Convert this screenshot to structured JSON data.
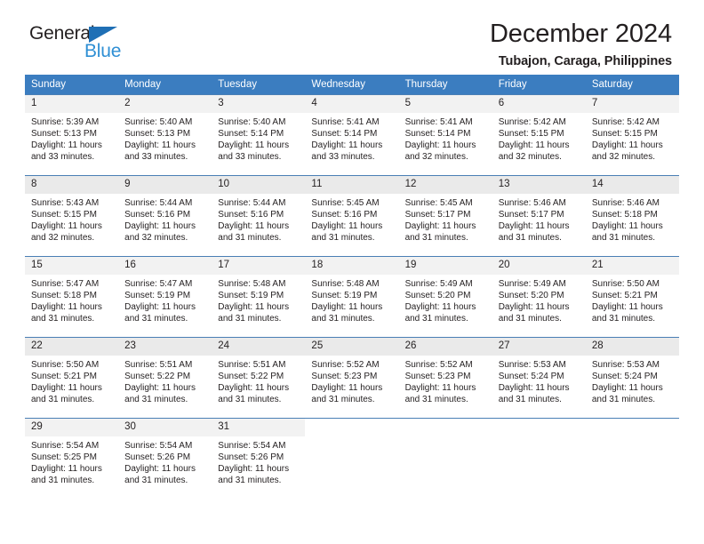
{
  "brand": {
    "word_one": "General",
    "word_two": "Blue",
    "triangle_color": "#1f6fb5",
    "blue_color": "#2f8fd4"
  },
  "header": {
    "title": "December 2024",
    "subtitle": "Tubajon, Caraga, Philippines"
  },
  "theme": {
    "header_bg": "#3b7dc0",
    "row_border": "#4a7fb5",
    "daynum_bg": "#f2f2f2"
  },
  "calendar": {
    "weekday_headers": [
      "Sunday",
      "Monday",
      "Tuesday",
      "Wednesday",
      "Thursday",
      "Friday",
      "Saturday"
    ],
    "weeks": [
      [
        {
          "day": "1",
          "sunrise": "Sunrise: 5:39 AM",
          "sunset": "Sunset: 5:13 PM",
          "daylight_line1": "Daylight: 11 hours",
          "daylight_line2": "and 33 minutes."
        },
        {
          "day": "2",
          "sunrise": "Sunrise: 5:40 AM",
          "sunset": "Sunset: 5:13 PM",
          "daylight_line1": "Daylight: 11 hours",
          "daylight_line2": "and 33 minutes."
        },
        {
          "day": "3",
          "sunrise": "Sunrise: 5:40 AM",
          "sunset": "Sunset: 5:14 PM",
          "daylight_line1": "Daylight: 11 hours",
          "daylight_line2": "and 33 minutes."
        },
        {
          "day": "4",
          "sunrise": "Sunrise: 5:41 AM",
          "sunset": "Sunset: 5:14 PM",
          "daylight_line1": "Daylight: 11 hours",
          "daylight_line2": "and 33 minutes."
        },
        {
          "day": "5",
          "sunrise": "Sunrise: 5:41 AM",
          "sunset": "Sunset: 5:14 PM",
          "daylight_line1": "Daylight: 11 hours",
          "daylight_line2": "and 32 minutes."
        },
        {
          "day": "6",
          "sunrise": "Sunrise: 5:42 AM",
          "sunset": "Sunset: 5:15 PM",
          "daylight_line1": "Daylight: 11 hours",
          "daylight_line2": "and 32 minutes."
        },
        {
          "day": "7",
          "sunrise": "Sunrise: 5:42 AM",
          "sunset": "Sunset: 5:15 PM",
          "daylight_line1": "Daylight: 11 hours",
          "daylight_line2": "and 32 minutes."
        }
      ],
      [
        {
          "day": "8",
          "sunrise": "Sunrise: 5:43 AM",
          "sunset": "Sunset: 5:15 PM",
          "daylight_line1": "Daylight: 11 hours",
          "daylight_line2": "and 32 minutes."
        },
        {
          "day": "9",
          "sunrise": "Sunrise: 5:44 AM",
          "sunset": "Sunset: 5:16 PM",
          "daylight_line1": "Daylight: 11 hours",
          "daylight_line2": "and 32 minutes."
        },
        {
          "day": "10",
          "sunrise": "Sunrise: 5:44 AM",
          "sunset": "Sunset: 5:16 PM",
          "daylight_line1": "Daylight: 11 hours",
          "daylight_line2": "and 31 minutes."
        },
        {
          "day": "11",
          "sunrise": "Sunrise: 5:45 AM",
          "sunset": "Sunset: 5:16 PM",
          "daylight_line1": "Daylight: 11 hours",
          "daylight_line2": "and 31 minutes."
        },
        {
          "day": "12",
          "sunrise": "Sunrise: 5:45 AM",
          "sunset": "Sunset: 5:17 PM",
          "daylight_line1": "Daylight: 11 hours",
          "daylight_line2": "and 31 minutes."
        },
        {
          "day": "13",
          "sunrise": "Sunrise: 5:46 AM",
          "sunset": "Sunset: 5:17 PM",
          "daylight_line1": "Daylight: 11 hours",
          "daylight_line2": "and 31 minutes."
        },
        {
          "day": "14",
          "sunrise": "Sunrise: 5:46 AM",
          "sunset": "Sunset: 5:18 PM",
          "daylight_line1": "Daylight: 11 hours",
          "daylight_line2": "and 31 minutes."
        }
      ],
      [
        {
          "day": "15",
          "sunrise": "Sunrise: 5:47 AM",
          "sunset": "Sunset: 5:18 PM",
          "daylight_line1": "Daylight: 11 hours",
          "daylight_line2": "and 31 minutes."
        },
        {
          "day": "16",
          "sunrise": "Sunrise: 5:47 AM",
          "sunset": "Sunset: 5:19 PM",
          "daylight_line1": "Daylight: 11 hours",
          "daylight_line2": "and 31 minutes."
        },
        {
          "day": "17",
          "sunrise": "Sunrise: 5:48 AM",
          "sunset": "Sunset: 5:19 PM",
          "daylight_line1": "Daylight: 11 hours",
          "daylight_line2": "and 31 minutes."
        },
        {
          "day": "18",
          "sunrise": "Sunrise: 5:48 AM",
          "sunset": "Sunset: 5:19 PM",
          "daylight_line1": "Daylight: 11 hours",
          "daylight_line2": "and 31 minutes."
        },
        {
          "day": "19",
          "sunrise": "Sunrise: 5:49 AM",
          "sunset": "Sunset: 5:20 PM",
          "daylight_line1": "Daylight: 11 hours",
          "daylight_line2": "and 31 minutes."
        },
        {
          "day": "20",
          "sunrise": "Sunrise: 5:49 AM",
          "sunset": "Sunset: 5:20 PM",
          "daylight_line1": "Daylight: 11 hours",
          "daylight_line2": "and 31 minutes."
        },
        {
          "day": "21",
          "sunrise": "Sunrise: 5:50 AM",
          "sunset": "Sunset: 5:21 PM",
          "daylight_line1": "Daylight: 11 hours",
          "daylight_line2": "and 31 minutes."
        }
      ],
      [
        {
          "day": "22",
          "sunrise": "Sunrise: 5:50 AM",
          "sunset": "Sunset: 5:21 PM",
          "daylight_line1": "Daylight: 11 hours",
          "daylight_line2": "and 31 minutes."
        },
        {
          "day": "23",
          "sunrise": "Sunrise: 5:51 AM",
          "sunset": "Sunset: 5:22 PM",
          "daylight_line1": "Daylight: 11 hours",
          "daylight_line2": "and 31 minutes."
        },
        {
          "day": "24",
          "sunrise": "Sunrise: 5:51 AM",
          "sunset": "Sunset: 5:22 PM",
          "daylight_line1": "Daylight: 11 hours",
          "daylight_line2": "and 31 minutes."
        },
        {
          "day": "25",
          "sunrise": "Sunrise: 5:52 AM",
          "sunset": "Sunset: 5:23 PM",
          "daylight_line1": "Daylight: 11 hours",
          "daylight_line2": "and 31 minutes."
        },
        {
          "day": "26",
          "sunrise": "Sunrise: 5:52 AM",
          "sunset": "Sunset: 5:23 PM",
          "daylight_line1": "Daylight: 11 hours",
          "daylight_line2": "and 31 minutes."
        },
        {
          "day": "27",
          "sunrise": "Sunrise: 5:53 AM",
          "sunset": "Sunset: 5:24 PM",
          "daylight_line1": "Daylight: 11 hours",
          "daylight_line2": "and 31 minutes."
        },
        {
          "day": "28",
          "sunrise": "Sunrise: 5:53 AM",
          "sunset": "Sunset: 5:24 PM",
          "daylight_line1": "Daylight: 11 hours",
          "daylight_line2": "and 31 minutes."
        }
      ],
      [
        {
          "day": "29",
          "sunrise": "Sunrise: 5:54 AM",
          "sunset": "Sunset: 5:25 PM",
          "daylight_line1": "Daylight: 11 hours",
          "daylight_line2": "and 31 minutes."
        },
        {
          "day": "30",
          "sunrise": "Sunrise: 5:54 AM",
          "sunset": "Sunset: 5:26 PM",
          "daylight_line1": "Daylight: 11 hours",
          "daylight_line2": "and 31 minutes."
        },
        {
          "day": "31",
          "sunrise": "Sunrise: 5:54 AM",
          "sunset": "Sunset: 5:26 PM",
          "daylight_line1": "Daylight: 11 hours",
          "daylight_line2": "and 31 minutes."
        },
        {
          "day": "",
          "sunrise": "",
          "sunset": "",
          "daylight_line1": "",
          "daylight_line2": ""
        },
        {
          "day": "",
          "sunrise": "",
          "sunset": "",
          "daylight_line1": "",
          "daylight_line2": ""
        },
        {
          "day": "",
          "sunrise": "",
          "sunset": "",
          "daylight_line1": "",
          "daylight_line2": ""
        },
        {
          "day": "",
          "sunrise": "",
          "sunset": "",
          "daylight_line1": "",
          "daylight_line2": ""
        }
      ]
    ]
  }
}
